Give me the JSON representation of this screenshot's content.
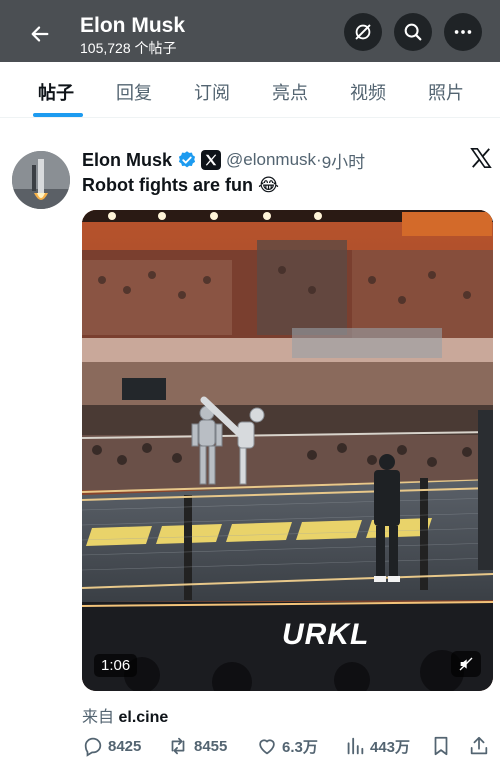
{
  "header": {
    "title": "Elon Musk",
    "post_count": "105,728 个帖子"
  },
  "tabs": [
    {
      "label": "帖子",
      "active": true
    },
    {
      "label": "回复",
      "active": false
    },
    {
      "label": "订阅",
      "active": false
    },
    {
      "label": "亮点",
      "active": false
    },
    {
      "label": "视频",
      "active": false
    },
    {
      "label": "照片",
      "active": false
    }
  ],
  "post": {
    "author": "Elon Musk",
    "handle": "@elonmusk",
    "separator": "·",
    "time": "9小时",
    "text": "Robot fights are fun 😂",
    "media": {
      "duration": "1:06",
      "banner_text": "URKL"
    },
    "source_prefix": "来自",
    "source_name": "el.cine",
    "stats": {
      "replies": "8425",
      "reposts": "8455",
      "likes": "6.3万",
      "views": "443万"
    }
  },
  "colors": {
    "header_bg": "#4b4f53",
    "accent": "#1d9bf0",
    "text": "#0f1419",
    "muted": "#536471"
  }
}
